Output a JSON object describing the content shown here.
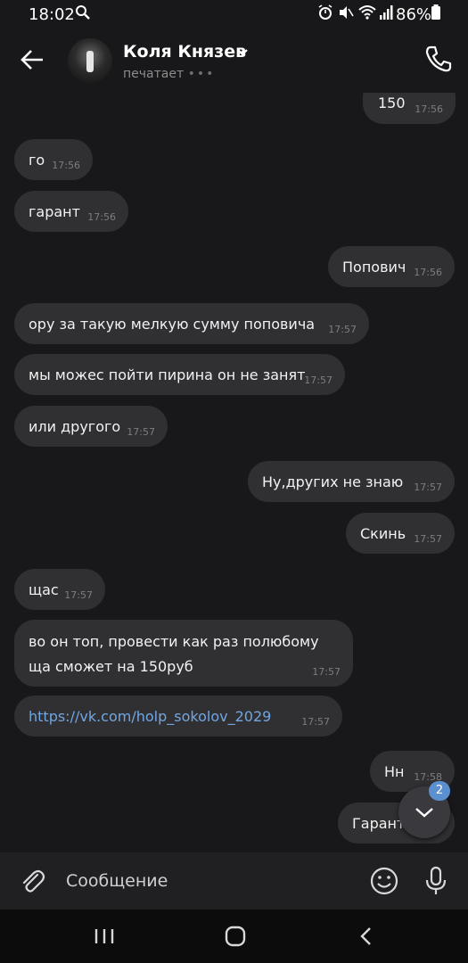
{
  "status_bar": {
    "time": "18:02",
    "battery": "86%",
    "icons": [
      "search-icon",
      "alarm-icon",
      "mute-icon",
      "wifi-icon",
      "signal-icon",
      "battery-icon"
    ]
  },
  "header": {
    "contact_name": "Коля Князев",
    "status": "печатает",
    "icons": [
      "back-arrow-icon",
      "chevron-down-icon",
      "phone-icon"
    ]
  },
  "messages": [
    {
      "direction": "out",
      "text": "150",
      "time": "17:56"
    },
    {
      "direction": "in",
      "text": "го",
      "time": "17:56"
    },
    {
      "direction": "in",
      "text": "гарант",
      "time": "17:56"
    },
    {
      "direction": "out",
      "text": "Попович",
      "time": "17:56"
    },
    {
      "direction": "in",
      "text": "ору за такую мелкую сумму поповича",
      "time": "17:57"
    },
    {
      "direction": "in",
      "text": "мы можес пойти пирина он не занят",
      "time": "17:57"
    },
    {
      "direction": "in",
      "text": "или другого",
      "time": "17:57"
    },
    {
      "direction": "out",
      "text": "Ну,других не знаю",
      "time": "17:57"
    },
    {
      "direction": "out",
      "text": "Скинь",
      "time": "17:57"
    },
    {
      "direction": "in",
      "text": "щас",
      "time": "17:57"
    },
    {
      "direction": "in",
      "text": "во он топ, провести как раз полюбому ща сможет на 150руб",
      "time": "17:57"
    },
    {
      "direction": "in",
      "text": "https://vk.com/holp_sokolov_2029",
      "time": "17:57",
      "is_link": true
    },
    {
      "direction": "out",
      "text": "Нн",
      "time": "17:58"
    },
    {
      "direction": "out",
      "text": "Гарант",
      "time": ""
    }
  ],
  "scroll_button": {
    "unread_count": "2",
    "icon": "chevron-down-icon"
  },
  "composer": {
    "placeholder": "Сообщение",
    "icons": [
      "paperclip-icon",
      "emoji-icon",
      "mic-icon"
    ]
  },
  "nav_bar": {
    "icons": [
      "recent-apps-icon",
      "home-icon",
      "back-icon"
    ]
  },
  "colors": {
    "background": "#18181a",
    "bubble": "#303033",
    "link": "#71a6e3",
    "badge": "#5a8fd0"
  }
}
